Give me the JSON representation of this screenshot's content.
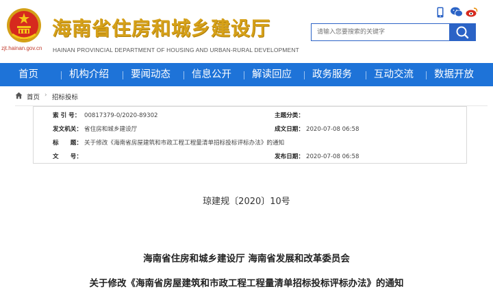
{
  "header": {
    "title_cn": "海南省住房和城乡建设厅",
    "title_en": "HAINAN PROVINCIAL DEPARTMENT OF HOUSING AND URBAN-RURAL DEVELOPMENT",
    "domain": "zjt.hainan.gov.cn",
    "icons": [
      "mobile-icon",
      "wechat-icon",
      "weibo-icon"
    ]
  },
  "search": {
    "placeholder": "请输入您要搜索的关键字"
  },
  "nav": {
    "items": [
      "首页",
      "机构介绍",
      "要闻动态",
      "信息公开",
      "解读回应",
      "政务服务",
      "互动交流",
      "数据开放"
    ]
  },
  "breadcrumb": {
    "home": "首页",
    "current": "招标投标"
  },
  "meta": {
    "index_label": "索 引 号：",
    "index_value": "00817379-0/2020-89302",
    "topic_label": "主题分类：",
    "topic_value": "",
    "issuer_label": "发文机关：",
    "issuer_value": "省住房和城乡建设厅",
    "created_label": "成文日期：",
    "created_value": "2020-07-08 06:58",
    "title_label": "标　　题：",
    "title_value": "关于修改《海南省房屋建筑和市政工程工程量清单招标投标评标办法》的通知",
    "docno_label": "文　　号：",
    "docno_value": "",
    "published_label": "发布日期：",
    "published_value": "2020-07-08 06:58"
  },
  "document": {
    "number": "琼建规〔2020〕10号",
    "issuers": "海南省住房和城乡建设厅 海南省发展和改革委员会",
    "title": "关于修改《海南省房屋建筑和市政工程工程量清单招标投标评标办法》的通知"
  },
  "colors": {
    "nav_bg": "#1e73d8",
    "title_gold": "#d6a119",
    "search_blue": "#2b63c6"
  }
}
